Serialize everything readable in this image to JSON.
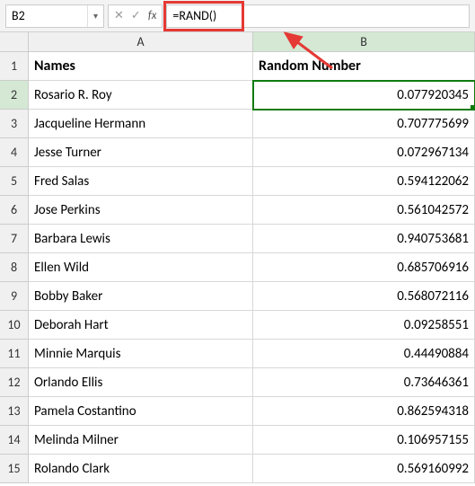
{
  "formula_bar": {
    "cell_ref": "B2",
    "fx_label": "fx",
    "formula": "=RAND()"
  },
  "columns": [
    "A",
    "B"
  ],
  "headers": {
    "col_a": "Names",
    "col_b": "Random Number"
  },
  "rows": [
    {
      "n": "1"
    },
    {
      "n": "2",
      "name": "Rosario R. Roy",
      "val": "0.077920345"
    },
    {
      "n": "3",
      "name": "Jacqueline Hermann",
      "val": "0.707775699"
    },
    {
      "n": "4",
      "name": "Jesse Turner",
      "val": "0.072967134"
    },
    {
      "n": "5",
      "name": "Fred Salas",
      "val": "0.594122062"
    },
    {
      "n": "6",
      "name": "Jose Perkins",
      "val": "0.561042572"
    },
    {
      "n": "7",
      "name": "Barbara Lewis",
      "val": "0.940753681"
    },
    {
      "n": "8",
      "name": "Ellen Wild",
      "val": "0.685706916"
    },
    {
      "n": "9",
      "name": "Bobby Baker",
      "val": "0.568072116"
    },
    {
      "n": "10",
      "name": "Deborah Hart",
      "val": "0.09258551"
    },
    {
      "n": "11",
      "name": "Minnie Marquis",
      "val": "0.44490884"
    },
    {
      "n": "12",
      "name": "Orlando Ellis",
      "val": "0.73646361"
    },
    {
      "n": "13",
      "name": "Pamela Costantino",
      "val": "0.862594318"
    },
    {
      "n": "14",
      "name": "Melinda Milner",
      "val": "0.106957155"
    },
    {
      "n": "15",
      "name": "Rolando Clark",
      "val": "0.569160992"
    }
  ]
}
